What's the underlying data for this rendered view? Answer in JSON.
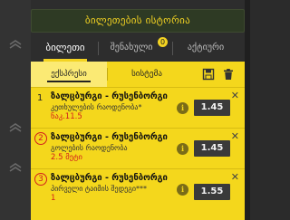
{
  "header": {
    "title": "ბილეთების ისტორია"
  },
  "tabs": [
    {
      "label": "ბილეთი",
      "active": true
    },
    {
      "label": "შენახული",
      "badge": "0"
    },
    {
      "label": "აქტიური"
    }
  ],
  "slip": {
    "subtabs": [
      {
        "label": "ექსპრესი",
        "active": true
      },
      {
        "label": "სისტემა"
      }
    ],
    "icons": [
      "save-icon",
      "trash-icon"
    ],
    "bets": [
      {
        "index": "1",
        "circled": false,
        "event": "ზალცბურგი - რუსენბორგი",
        "market": "კეთხულების რაოდენობა*",
        "pick": "ნაკ.11.5",
        "pick_color": "red",
        "odds": "1.45"
      },
      {
        "index": "2",
        "circled": true,
        "event": "ზალცბურგი - რუსენბორგი",
        "market": "გოლების რაოდენობა",
        "pick": "2.5 მეტი",
        "pick_color": "red",
        "odds": "1.45"
      },
      {
        "index": "3",
        "circled": true,
        "event": "ზალცბურგი - რუსენბორგი",
        "market": "პირველი ტაიმის შედეგი***",
        "pick": "1",
        "pick_color": "red",
        "odds": "1.55"
      }
    ]
  },
  "colors": {
    "accent": "#f4d71c",
    "title_text": "#f3d322",
    "dark": "#2d2d2d",
    "error": "#d3201c"
  }
}
